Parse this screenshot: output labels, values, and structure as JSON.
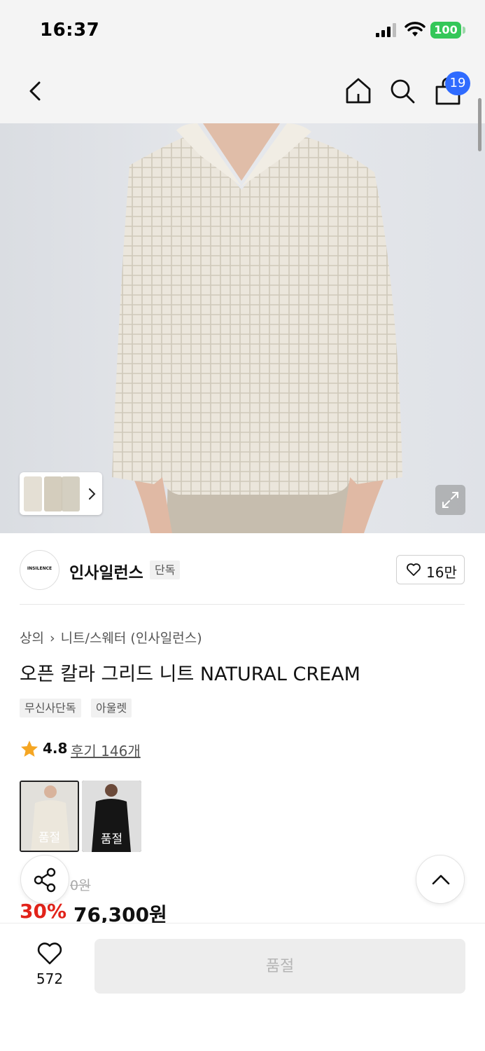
{
  "status_bar": {
    "time": "16:37",
    "battery": "100"
  },
  "nav": {
    "cart_count": "19"
  },
  "brand": {
    "logo_text": "INSILENCE",
    "name": "인사일런스",
    "tag": "단독",
    "like_count": "16만"
  },
  "breadcrumb": [
    "상의",
    "니트/스웨터 (인사일런스)"
  ],
  "product": {
    "title": "오픈 칼라 그리드 니트 NATURAL CREAM",
    "tags": [
      "무신사단독",
      "아울렛"
    ],
    "rating": "4.8",
    "review_text": "후기 146개",
    "colors": [
      {
        "sold_label": "품절",
        "color": "#d9d4c7"
      },
      {
        "sold_label": "품절",
        "color": "#1c1c1c"
      }
    ]
  },
  "price": {
    "original": "0원",
    "discount": "30%",
    "sale": "76,300원"
  },
  "bottom_bar": {
    "wish_count": "572",
    "buy_label": "품절"
  },
  "colors": {
    "accent_badge": "#2f6bff",
    "discount": "#e2231a",
    "battery": "#34c759"
  },
  "icons": [
    "back-arrow-icon",
    "home-icon",
    "search-icon",
    "cart-icon",
    "chevron-right-icon",
    "expand-icon",
    "heart-icon",
    "star-icon",
    "share-icon",
    "chevron-up-icon"
  ]
}
